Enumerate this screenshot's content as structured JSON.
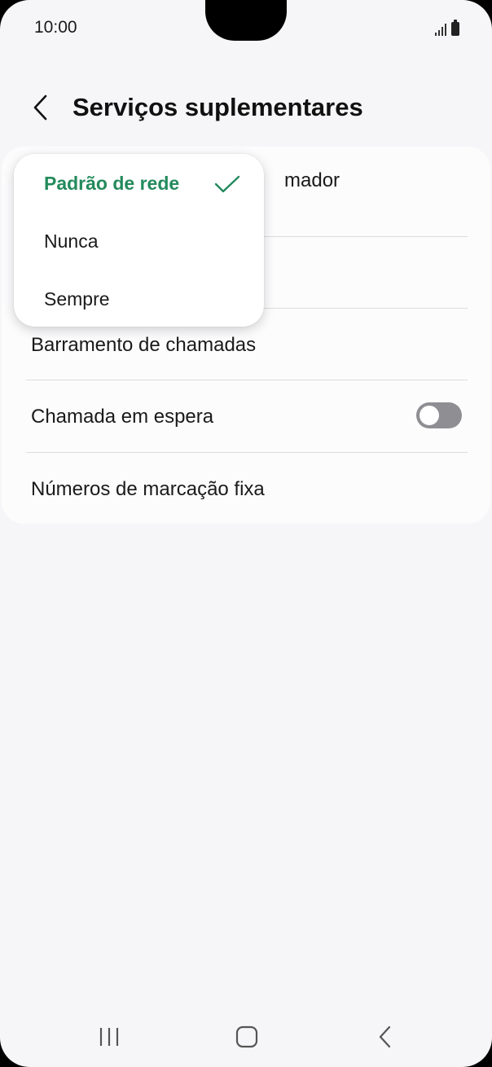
{
  "status_bar": {
    "time": "10:00",
    "icons": [
      "signal-icon",
      "battery-icon"
    ]
  },
  "header": {
    "title": "Serviços suplementares",
    "back_icon": "chevron-left-icon"
  },
  "settings": {
    "items": [
      {
        "label": "mador"
      },
      {
        "label": "Barramento de chamadas"
      },
      {
        "label": "Chamada em espera",
        "toggle": false
      },
      {
        "label": "Números de marcação fixa"
      }
    ]
  },
  "popup": {
    "options": [
      {
        "label": "Padrão de rede",
        "selected": true
      },
      {
        "label": "Nunca",
        "selected": false
      },
      {
        "label": "Sempre",
        "selected": false
      }
    ],
    "selected_color": "#238a5c"
  },
  "navbar": {
    "buttons": [
      "recent-apps-icon",
      "home-icon",
      "back-icon"
    ]
  }
}
